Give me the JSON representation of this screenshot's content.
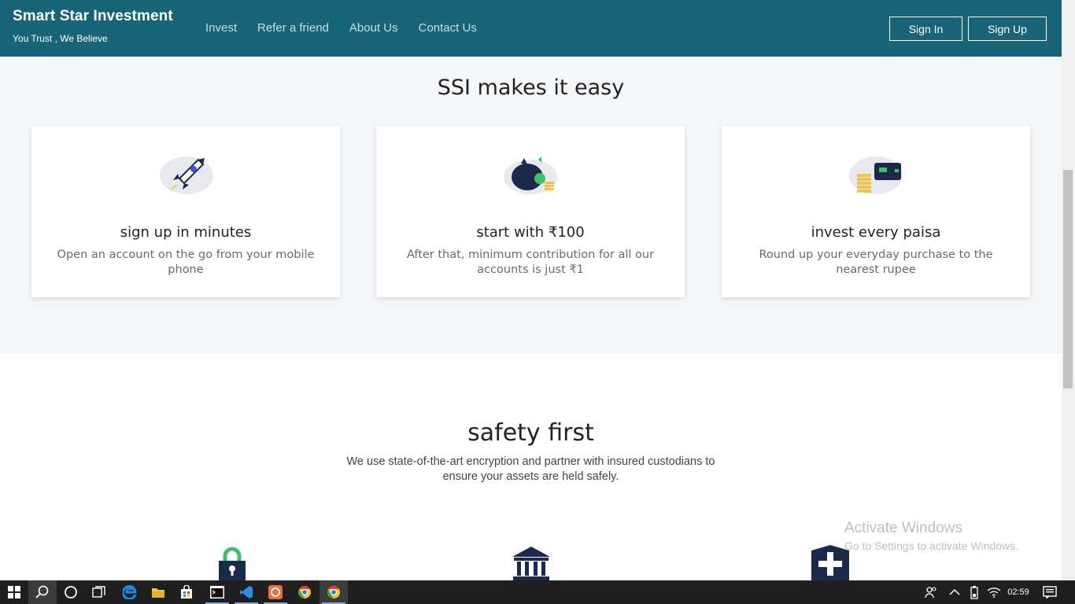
{
  "header": {
    "brand_title": "Smart Star Investment",
    "brand_subtitle": "You Trust , We Believe",
    "nav": [
      "Invest",
      "Refer a friend",
      "About Us",
      "Contact Us"
    ],
    "sign_in_label": "Sign In",
    "sign_up_label": "Sign Up",
    "bg_color": "#176577"
  },
  "easy_section": {
    "title": "SSI makes it easy",
    "cards": [
      {
        "icon": "rocket-icon",
        "title": "sign up in minutes",
        "description": "Open an account on the go from your mobile phone"
      },
      {
        "icon": "piggy-bank-icon",
        "title": "start with ₹100",
        "description": "After that, minimum contribution for all our accounts is just ₹1"
      },
      {
        "icon": "card-coins-icon",
        "title": "invest every paisa",
        "description": "Round up your everyday purchase to the nearest rupee"
      }
    ]
  },
  "safety_section": {
    "title": "safety first",
    "description": "We use state-of-the-art encryption and partner with insured custodians to ensure your assets are held safely.",
    "icons": [
      "lock-icon",
      "bank-icon",
      "shield-plus-icon"
    ]
  },
  "watermark": {
    "title": "Activate Windows",
    "subtitle": "Go to Settings to activate Windows."
  },
  "taskbar": {
    "clock": "02:59",
    "apps": [
      "start-icon",
      "search-icon",
      "cortana-icon",
      "task-view-icon",
      "edge-icon",
      "file-explorer-icon",
      "store-icon",
      "cmd-icon",
      "vscode-icon",
      "app-icon",
      "chrome-icon",
      "chrome-active-icon"
    ],
    "tray": [
      "people-icon",
      "chevron-up-icon",
      "battery-icon",
      "wifi-icon",
      "notification-icon"
    ]
  }
}
